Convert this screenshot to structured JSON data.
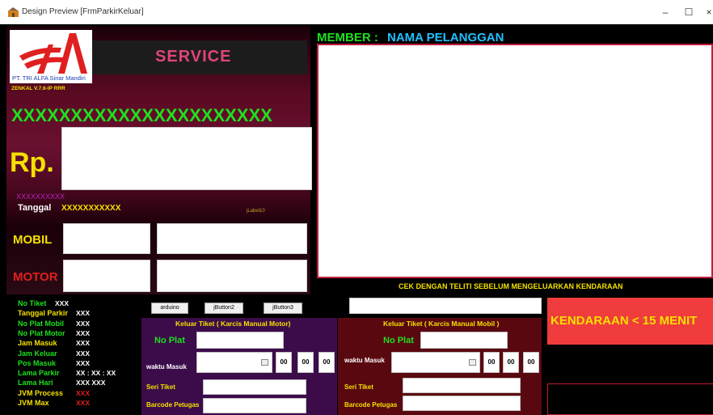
{
  "window": {
    "title": "Design Preview [FrmParkirKeluar]",
    "minimize": "–",
    "maximize": "☐",
    "close": "×"
  },
  "logo": {
    "company": "PT. TRI ALFA Sinar Mandiri",
    "version": "ZENKAL V.7.6-IP RRR"
  },
  "service": "SERVICE",
  "banner": "XXXXXXXXXXXXXXXXXXXXXX",
  "rp": "Rp.",
  "magenta_x": "XXXXXXXXXX",
  "tanggal": {
    "label": "Tanggal",
    "value": "XXXXXXXXXXX"
  },
  "label10": "jLabel10",
  "mobil": "MOBIL",
  "motor": "MOTOR",
  "member": {
    "label": "MEMBER :",
    "value": "NAMA PELANGGAN"
  },
  "cek": "CEK DENGAN TELITI SEBELUM MENGELUARKAN KENDARAAN",
  "warning": "KENDARAAN < 15 MENIT",
  "info": [
    {
      "label": "No Tiket",
      "value": "XXX",
      "label_color": "#1ee01e"
    },
    {
      "label": "Tanggal Parkir",
      "value": "XXX",
      "label_color": "#f5e000"
    },
    {
      "label": "No Plat Mobil",
      "value": "XXX",
      "label_color": "#1ee01e"
    },
    {
      "label": "No Plat Motor",
      "value": "XXX",
      "label_color": "#1ee01e"
    },
    {
      "label": "Jam Masuk",
      "value": "XXX",
      "label_color": "#f5e000"
    },
    {
      "label": "Jam Keluar",
      "value": "XXX",
      "label_color": "#1ee01e"
    },
    {
      "label": "Pos Masuk",
      "value": "XXX",
      "label_color": "#1ee01e"
    },
    {
      "label": "Lama Parkir",
      "value": "XX : XX : XX",
      "label_color": "#1ee01e"
    },
    {
      "label": "Lama Hari",
      "value": "XXX XXX",
      "label_color": "#1ee01e"
    },
    {
      "label": "JVM Process",
      "value": "XXX",
      "label_color": "#f5e000"
    },
    {
      "label": "JVM Max",
      "value": "XXX",
      "label_color": "#f5e000"
    }
  ],
  "buttons": {
    "arduino": "arduino",
    "b2": "jButton2",
    "b3": "jButton3"
  },
  "motor_panel": {
    "title": "Keluar Tiket ( Karcis Manual Motor)",
    "no_plat": "No Plat",
    "waktu": "waktu Masuk",
    "seri": "Seri Tiket",
    "barcode": "Barcode Petugas",
    "h": "00",
    "m": "00",
    "s": "00"
  },
  "car_panel": {
    "title": "Keluar Tiket ( Karcis Manual Mobil )",
    "no_plat": "No Plat",
    "waktu": "waktu Masuk",
    "seri": "Seri Tiket",
    "barcode": "Barcode Petugas",
    "h": "00",
    "m": "00",
    "s": "00"
  },
  "colors": {
    "accent_green": "#1ee01e",
    "accent_yellow": "#f5e000",
    "warning_bg": "#f03c3c",
    "service_text": "#e0447a"
  }
}
